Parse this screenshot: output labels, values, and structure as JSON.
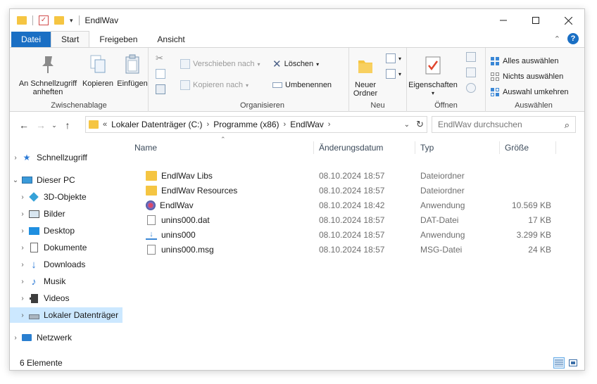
{
  "window": {
    "title": "EndlWav"
  },
  "ribbon_tabs": [
    "Datei",
    "Start",
    "Freigeben",
    "Ansicht"
  ],
  "ribbon": {
    "clipboard": {
      "label": "Zwischenablage",
      "pin_line1": "An Schnellzugriff",
      "pin_line2": "anheften",
      "copy": "Kopieren",
      "paste": "Einfügen"
    },
    "organize": {
      "label": "Organisieren",
      "move": "Verschieben nach",
      "copy_to": "Kopieren nach",
      "delete": "Löschen",
      "rename": "Umbenennen"
    },
    "new": {
      "label": "Neu",
      "folder_line1": "Neuer",
      "folder_line2": "Ordner"
    },
    "open": {
      "label": "Öffnen",
      "properties": "Eigenschaften"
    },
    "select": {
      "label": "Auswählen",
      "all": "Alles auswählen",
      "none": "Nichts auswählen",
      "invert": "Auswahl umkehren"
    }
  },
  "address": {
    "prefix": "«",
    "crumbs": [
      "Lokaler Datenträger (C:)",
      "Programme (x86)",
      "EndlWav"
    ],
    "search_placeholder": "EndlWav durchsuchen"
  },
  "nav": {
    "quick": "Schnellzugriff",
    "pc": "Dieser PC",
    "objects3d": "3D-Objekte",
    "pictures": "Bilder",
    "desktop": "Desktop",
    "documents": "Dokumente",
    "downloads": "Downloads",
    "music": "Musik",
    "videos": "Videos",
    "local_disk": "Lokaler Datenträger",
    "network": "Netzwerk"
  },
  "columns": {
    "name": "Name",
    "date": "Änderungsdatum",
    "type": "Typ",
    "size": "Größe"
  },
  "files": [
    {
      "name": "EndlWav Libs",
      "date": "08.10.2024 18:57",
      "type": "Dateiordner",
      "size": "",
      "icon": "folder-icon"
    },
    {
      "name": "EndlWav Resources",
      "date": "08.10.2024 18:57",
      "type": "Dateiordner",
      "size": "",
      "icon": "folder-icon"
    },
    {
      "name": "EndlWav",
      "date": "08.10.2024 18:42",
      "type": "Anwendung",
      "size": "10.569 KB",
      "icon": "app-icon"
    },
    {
      "name": "unins000.dat",
      "date": "08.10.2024 18:57",
      "type": "DAT-Datei",
      "size": "17 KB",
      "icon": "file-icon"
    },
    {
      "name": "unins000",
      "date": "08.10.2024 18:57",
      "type": "Anwendung",
      "size": "3.299 KB",
      "icon": "uninstaller-icon"
    },
    {
      "name": "unins000.msg",
      "date": "08.10.2024 18:57",
      "type": "MSG-Datei",
      "size": "24 KB",
      "icon": "file-icon"
    }
  ],
  "status": {
    "count_text": "6 Elemente"
  },
  "colors": {
    "accent": "#1a6fc4",
    "selection": "#cce8ff",
    "folder": "#f5c542"
  }
}
